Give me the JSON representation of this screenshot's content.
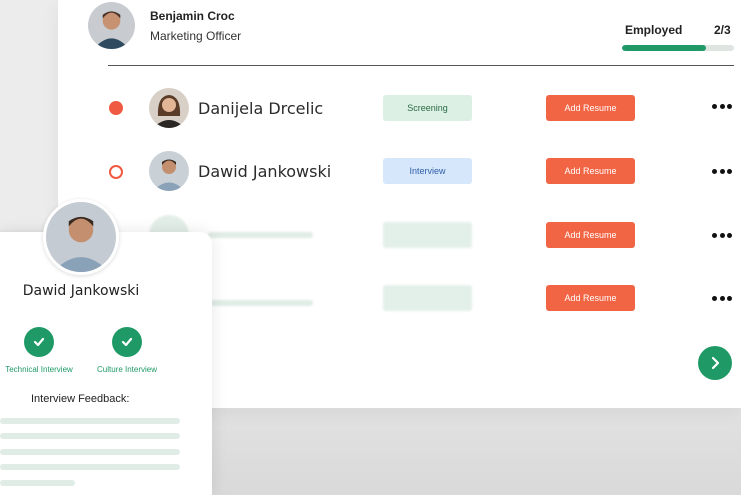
{
  "header": {
    "name": "Benjamin Croc",
    "role": "Marketing Officer",
    "status_label": "Employed",
    "status_count": "2/3",
    "progress_fraction": 0.75
  },
  "candidates": [
    {
      "name": "Danijela Drcelic",
      "stage": "Screening",
      "action": "Add Resume",
      "status": "filled"
    },
    {
      "name": "Dawid Jankowski",
      "stage": "Interview",
      "action": "Add Resume",
      "status": "outline"
    },
    {
      "name": "",
      "stage": "",
      "action": "Add Resume",
      "status": "blurred"
    },
    {
      "name": "",
      "stage": "",
      "action": "Add Resume",
      "status": "blurred"
    }
  ],
  "profile": {
    "name": "Dawid Jankowski",
    "checks": [
      {
        "label": "Technical Interview"
      },
      {
        "label": "Culture Interview"
      }
    ],
    "feedback_label": "Interview Feedback:"
  },
  "icons": {
    "more": "more-horizontal-icon",
    "next": "chevron-right-icon",
    "check": "check-icon"
  },
  "colors": {
    "accent_green": "#1f9a66",
    "accent_orange": "#f26544",
    "screening_bg": "#dcf0e4",
    "interview_bg": "#d6e6fb"
  }
}
